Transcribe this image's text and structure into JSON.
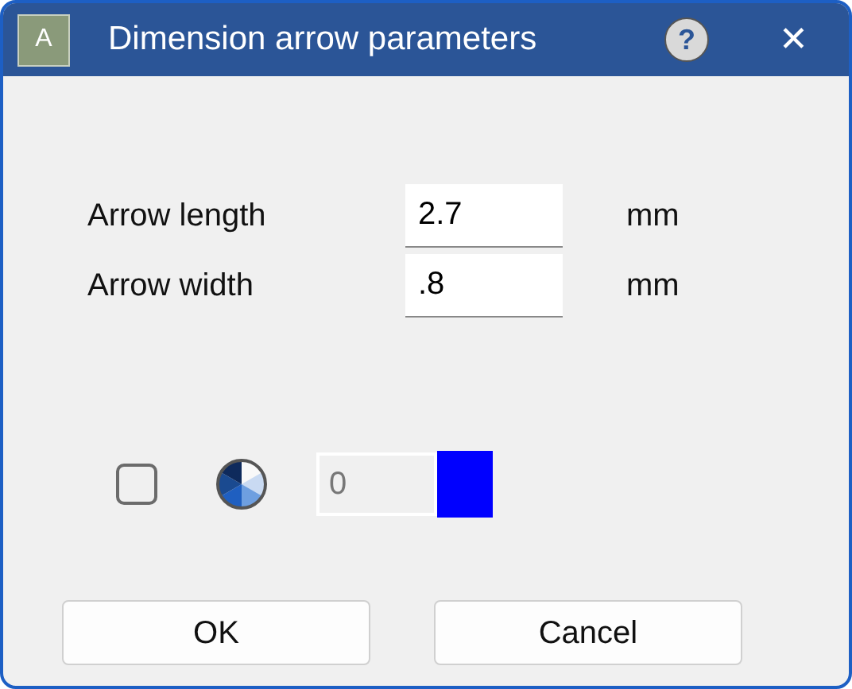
{
  "window": {
    "title": "Dimension arrow parameters",
    "app_icon_letter": "A",
    "help": "?",
    "close": "✕"
  },
  "params": [
    {
      "label": "Arrow length",
      "value": "2.7",
      "unit": "mm"
    },
    {
      "label": "Arrow width",
      "value": ".8",
      "unit": "mm"
    }
  ],
  "color_row": {
    "checked": false,
    "index_value": "0",
    "index_disabled": true,
    "color": "#0000ff"
  },
  "buttons": [
    "OK",
    "Cancel"
  ]
}
